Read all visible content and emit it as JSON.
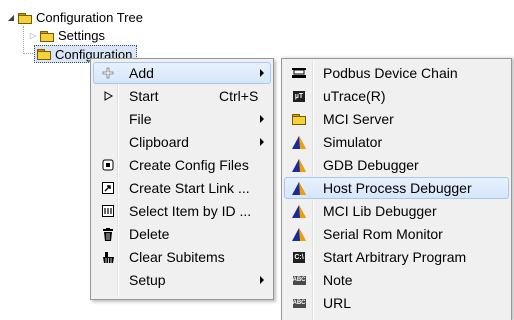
{
  "tree": {
    "root_label": "Configuration Tree",
    "children": [
      {
        "label": "Settings"
      },
      {
        "label": "Configuration"
      }
    ]
  },
  "context_menu": {
    "items": [
      {
        "label": "Add",
        "icon": "plus-icon",
        "shortcut": "",
        "submenu": true,
        "highlighted": true
      },
      {
        "label": "Start",
        "icon": "play-icon",
        "shortcut": "Ctrl+S",
        "submenu": false
      },
      {
        "label": "File",
        "icon": "",
        "shortcut": "",
        "submenu": true
      },
      {
        "label": "Clipboard",
        "icon": "",
        "shortcut": "",
        "submenu": true
      },
      {
        "label": "Create Config Files",
        "icon": "config-files-icon",
        "shortcut": "",
        "submenu": false
      },
      {
        "label": "Create Start Link ...",
        "icon": "link-icon",
        "shortcut": "",
        "submenu": false
      },
      {
        "label": "Select Item by ID ...",
        "icon": "id-icon",
        "shortcut": "",
        "submenu": false
      },
      {
        "label": "Delete",
        "icon": "trash-icon",
        "shortcut": "",
        "submenu": false
      },
      {
        "label": "Clear Subitems",
        "icon": "broom-icon",
        "shortcut": "",
        "submenu": false
      },
      {
        "label": "Setup",
        "icon": "",
        "shortcut": "",
        "submenu": true
      }
    ]
  },
  "add_submenu": {
    "items": [
      {
        "label": "Podbus Device Chain",
        "icon": "chain-icon"
      },
      {
        "label": "uTrace(R)",
        "icon": "utrace-icon"
      },
      {
        "label": "MCI Server",
        "icon": "folder-icon"
      },
      {
        "label": "Simulator",
        "icon": "triangle-icon"
      },
      {
        "label": "GDB Debugger",
        "icon": "triangle-icon"
      },
      {
        "label": "Host Process Debugger",
        "icon": "triangle-icon",
        "highlighted": true
      },
      {
        "label": "MCI Lib Debugger",
        "icon": "triangle-icon"
      },
      {
        "label": "Serial Rom Monitor",
        "icon": "triangle-icon"
      },
      {
        "label": "Start Arbitrary Program",
        "icon": "program-icon"
      },
      {
        "label": "Note",
        "icon": "note-icon"
      },
      {
        "label": "URL",
        "icon": "url-icon"
      }
    ]
  },
  "colors": {
    "menu_bg": "#f0f0f0",
    "highlight_bg": "#d6e6fa",
    "highlight_border": "#a8c8ee",
    "triangle_blue": "#1a2a9a",
    "triangle_orange": "#f0a000",
    "folder_yellow": "#f6d23a"
  }
}
